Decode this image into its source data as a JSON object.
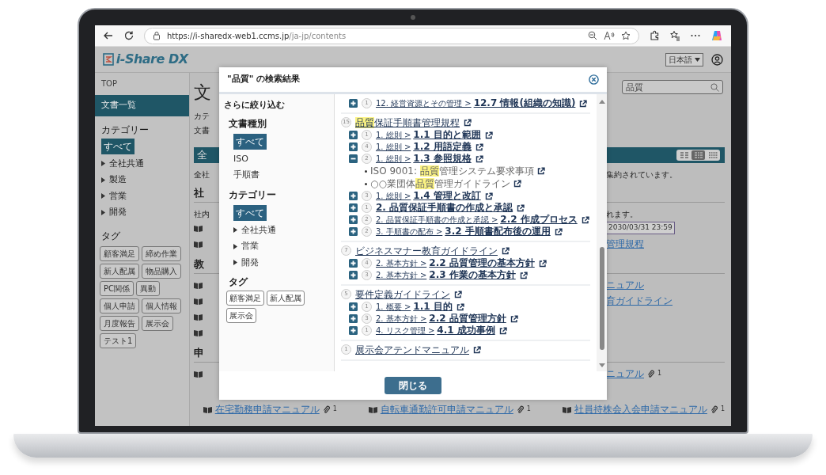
{
  "browser": {
    "url_host": "https://i-sharedx-web1.ccms.jp",
    "url_path": "/ja-jp/contents"
  },
  "app_header": {
    "logo": "i-Share DX",
    "language": "日本語"
  },
  "sidebar": {
    "breadcrumb": "TOP",
    "nav": [
      {
        "label": "文書一覧",
        "selected": true
      }
    ],
    "category_heading": "カテゴリー",
    "categories": [
      {
        "label": "すべて",
        "selected": true,
        "has_children": false
      },
      {
        "label": "全社共通",
        "selected": false,
        "has_children": true
      },
      {
        "label": "製造",
        "selected": false,
        "has_children": true
      },
      {
        "label": "営業",
        "selected": false,
        "has_children": true
      },
      {
        "label": "開発",
        "selected": false,
        "has_children": true
      }
    ],
    "tag_heading": "タグ",
    "tags": [
      "顧客満足",
      "締め作業",
      "新人配属",
      "物品購入",
      "PC関係",
      "異動",
      "個人申請",
      "個人情報",
      "月度報告",
      "展示会",
      "テスト1"
    ]
  },
  "main": {
    "rows": [
      {
        "kind": "title",
        "left": "文",
        "search": {
          "value": "品質"
        }
      },
      {
        "kind": "text",
        "left": "カテ"
      },
      {
        "kind": "text",
        "left": "文書"
      },
      {
        "kind": "bar",
        "left": "全",
        "views": [
          {
            "selected": false
          },
          {
            "selected": true
          },
          {
            "selected": false
          }
        ]
      },
      {
        "kind": "text",
        "left": "全社",
        "right": "集約されています。"
      },
      {
        "kind": "heading",
        "left": "社"
      },
      {
        "kind": "text",
        "left": "社内",
        "right": "れます。"
      },
      {
        "kind": "doc",
        "badge": "2030/03/31 23:59"
      },
      {
        "kind": "doc",
        "link": "管理規程"
      },
      {
        "kind": "heading",
        "left": "教"
      },
      {
        "kind": "doc",
        "link": "ニュアル"
      },
      {
        "kind": "doc",
        "link": "育ガイドライン"
      },
      {
        "kind": "doc"
      },
      {
        "kind": "doc"
      },
      {
        "kind": "heading",
        "left": "申"
      },
      {
        "kind": "doc",
        "link": "ニュアル",
        "attachments": "1"
      },
      {
        "kind": "docs",
        "items": [
          {
            "title": "在宅勤務申請マニュアル",
            "attachments": "1"
          },
          {
            "title": "自転車通勤許可申請マニュアル",
            "attachments": "1"
          },
          {
            "title": "社員持株会入会申請マニュアル",
            "attachments": "1"
          }
        ]
      }
    ]
  },
  "modal": {
    "title": "\"品質\" の検索結果",
    "filter": {
      "heading": "さらに絞り込む",
      "doc_type_heading": "文書種別",
      "doc_types": [
        {
          "label": "すべて",
          "selected": true
        },
        {
          "label": "ISO",
          "selected": false
        },
        {
          "label": "手順書",
          "selected": false
        }
      ],
      "category_heading": "カテゴリー",
      "categories": [
        {
          "label": "すべて",
          "selected": true,
          "has_children": false
        },
        {
          "label": "全社共通",
          "selected": false,
          "has_children": true
        },
        {
          "label": "営業",
          "selected": false,
          "has_children": true
        },
        {
          "label": "開発",
          "selected": false,
          "has_children": true
        }
      ],
      "tag_heading": "タグ",
      "tags": [
        "顧客満足",
        "新人配属",
        "展示会"
      ]
    },
    "results": [
      {
        "rows": [
          {
            "count": "1",
            "expanded": false,
            "path": "12. 経営資源とその管理 >",
            "section": "12.7 情報(組織の知識)"
          }
        ]
      },
      {
        "count": "15",
        "title": [
          {
            "text": "品質",
            "highlight": true
          },
          {
            "text": "保証手順書管理規程",
            "highlight": false
          }
        ],
        "rows": [
          {
            "count": "1",
            "expanded": false,
            "path": "1. 総則 >",
            "section": "1.1 目的と範囲"
          },
          {
            "count": "4",
            "expanded": false,
            "path": "1. 総則 >",
            "section": "1.2 用語定義"
          },
          {
            "count": "2",
            "expanded": true,
            "path": "1. 総則 >",
            "section": "1.3 参照規格",
            "refs": [
              [
                {
                  "text": "ISO 9001: ",
                  "highlight": false
                },
                {
                  "text": "品質",
                  "highlight": true
                },
                {
                  "text": "管理システム要求事項",
                  "highlight": false
                }
              ],
              [
                {
                  "text": "○○業団体",
                  "highlight": false
                },
                {
                  "text": "品質",
                  "highlight": true
                },
                {
                  "text": "管理ガイドライン",
                  "highlight": false
                }
              ]
            ]
          },
          {
            "count": "3",
            "expanded": false,
            "path": "1. 総則 >",
            "section": "1.4 管理と改訂"
          },
          {
            "count": "1",
            "expanded": false,
            "section": "2. 品質保証手順書の作成と承認"
          },
          {
            "count": "2",
            "expanded": false,
            "path": "2. 品質保証手順書の作成と承認 >",
            "section": "2.2 作成プロセス"
          },
          {
            "count": "2",
            "expanded": false,
            "path": "3. 手順書の配布 >",
            "section": "3.2 手順書配布後の運用"
          }
        ]
      },
      {
        "count": "7",
        "title": [
          {
            "text": "ビジネスマナー教育ガイドライン",
            "highlight": false
          }
        ],
        "rows": [
          {
            "count": "4",
            "expanded": false,
            "path": "2. 基本方針 >",
            "section": "2.2 品質管理の基本方針"
          },
          {
            "count": "3",
            "expanded": false,
            "path": "2. 基本方針 >",
            "section": "2.3 作業の基本方針"
          }
        ]
      },
      {
        "count": "5",
        "title": [
          {
            "text": "要件定義ガイドライン",
            "highlight": false
          }
        ],
        "rows": [
          {
            "count": "1",
            "expanded": false,
            "path": "1. 概要 >",
            "section": "1.1 目的"
          },
          {
            "count": "3",
            "expanded": false,
            "path": "2. 基本方針 >",
            "section": "2.2 品質管理方針"
          },
          {
            "count": "1",
            "expanded": false,
            "path": "4. リスク管理 >",
            "section": "4.1 成功事例"
          }
        ]
      },
      {
        "count": "1",
        "title": [
          {
            "text": "展示会アテンドマニュアル",
            "highlight": false
          }
        ]
      }
    ],
    "close_button": "閉じる"
  }
}
